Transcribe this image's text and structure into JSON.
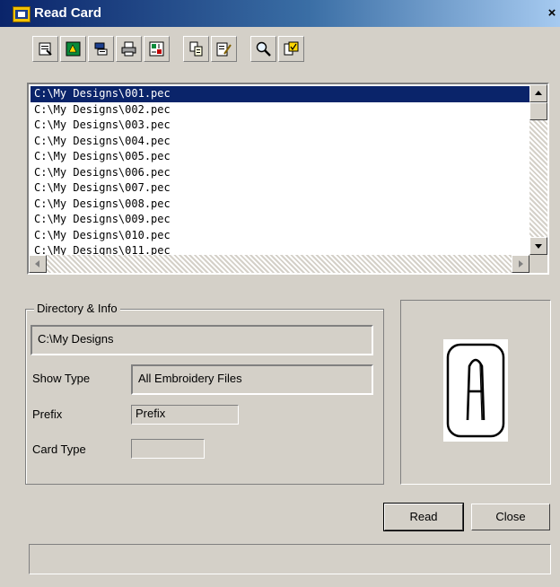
{
  "window": {
    "title": "Read Card",
    "close_glyph": "×"
  },
  "toolbar": {
    "buttons": [
      {
        "name": "properties-icon"
      },
      {
        "name": "view-design-icon"
      },
      {
        "name": "list-view-icon"
      },
      {
        "name": "print-icon"
      },
      {
        "name": "settings-icon"
      },
      {
        "name": "copy-icon"
      },
      {
        "name": "edit-icon"
      },
      {
        "name": "zoom-icon"
      },
      {
        "name": "select-all-icon"
      }
    ]
  },
  "file_list": {
    "items": [
      "C:\\My Designs\\001.pec",
      "C:\\My Designs\\002.pec",
      "C:\\My Designs\\003.pec",
      "C:\\My Designs\\004.pec",
      "C:\\My Designs\\005.pec",
      "C:\\My Designs\\006.pec",
      "C:\\My Designs\\007.pec",
      "C:\\My Designs\\008.pec",
      "C:\\My Designs\\009.pec",
      "C:\\My Designs\\010.pec",
      "C:\\My Designs\\011.pec"
    ],
    "selected_index": 0
  },
  "directory_info": {
    "group_label": "Directory & Info",
    "path": "C:\\My Designs",
    "show_type_label": "Show Type",
    "show_type_value": "All Embroidery Files",
    "prefix_label": "Prefix",
    "prefix_value": "Prefix",
    "card_type_label": "Card Type",
    "card_type_value": ""
  },
  "preview": {
    "icon": "embroidery-card-letter-a-icon"
  },
  "buttons": {
    "read": "Read",
    "close": "Close"
  },
  "status": {
    "text": ""
  },
  "colors": {
    "title_bar": "#0a246a",
    "selection": "#0a246a",
    "face": "#d4d0c8"
  }
}
